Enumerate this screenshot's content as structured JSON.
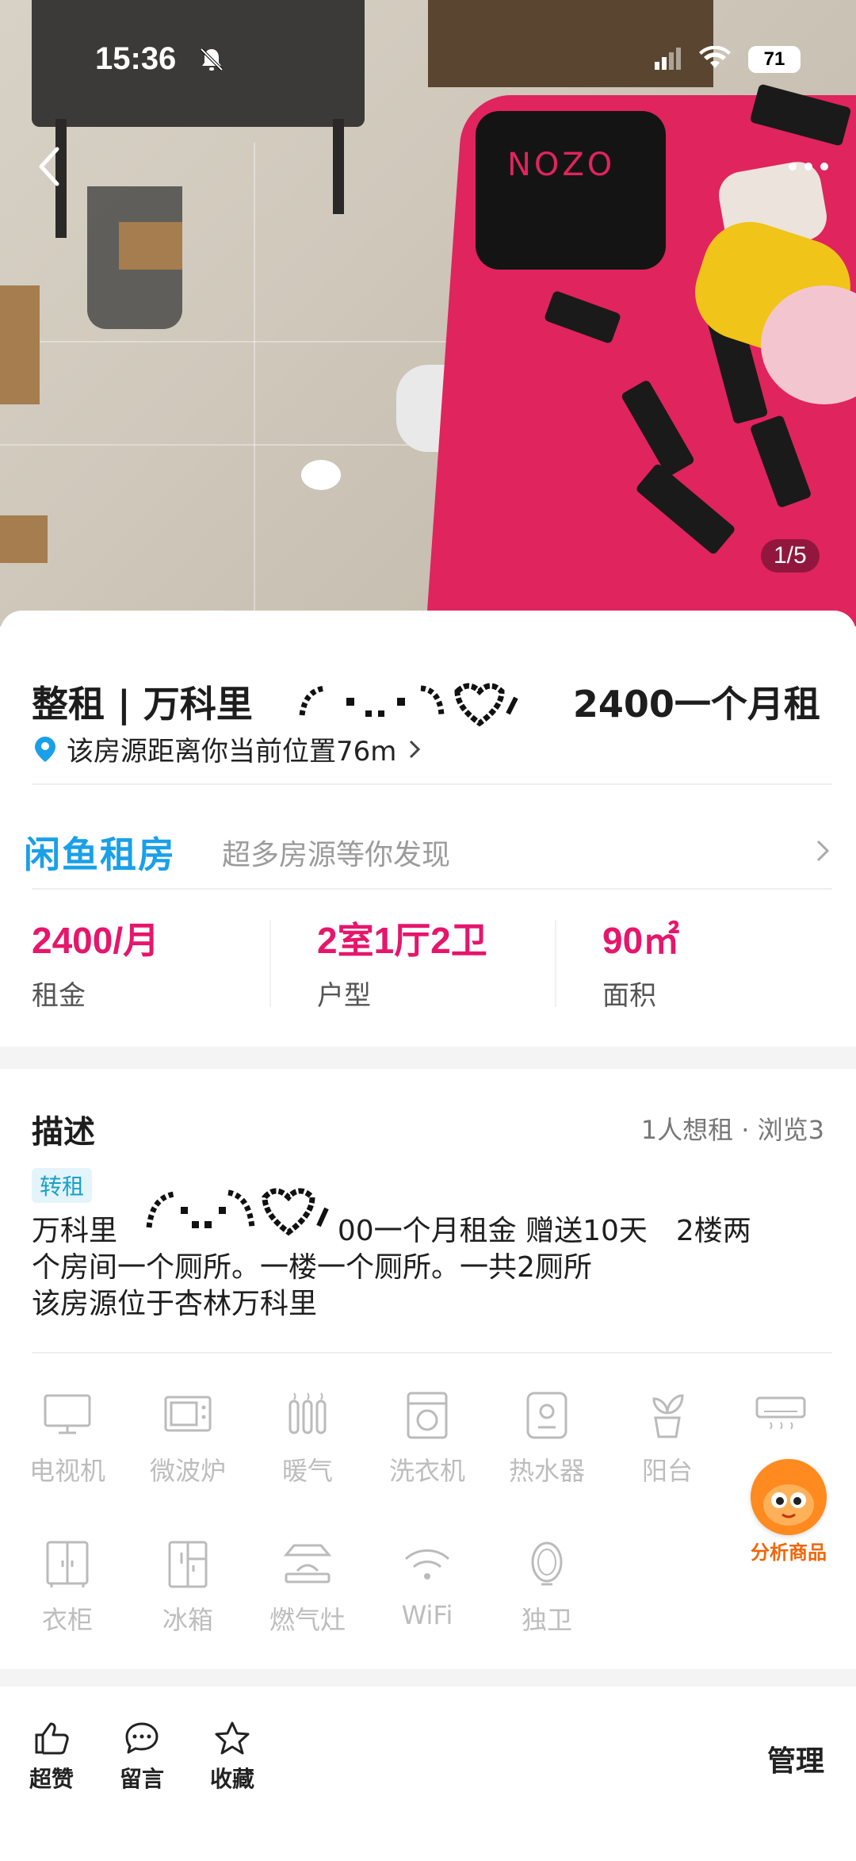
{
  "status_bar": {
    "time": "15:36",
    "battery": "71"
  },
  "gallery": {
    "counter": "1/5",
    "pillow_text": "NOZO"
  },
  "listing": {
    "title_prefix": "整租 | 万科里",
    "title_suffix": "2400一个月租",
    "location_text": "该房源距离你当前位置76m"
  },
  "brand": {
    "logo": "闲鱼租房",
    "subtitle": "超多房源等你发现"
  },
  "stats": [
    {
      "value": "2400/月",
      "label": "租金"
    },
    {
      "value": "2室1厅2卫",
      "label": "户型"
    },
    {
      "value": "90㎡",
      "label": "面积"
    }
  ],
  "description": {
    "heading": "描述",
    "meta": "1人想租 · 浏览3",
    "tag": "转租",
    "line1_prefix": "万科里",
    "line1_suffix": "2400一个月租金 赠送10天　2楼两",
    "line2": "个房间一个厕所。一楼一个厕所。一共2厕所",
    "line3": "该房源位于杏林万科里"
  },
  "amenities": [
    {
      "label": "电视机",
      "icon": "tv-icon"
    },
    {
      "label": "微波炉",
      "icon": "microwave-icon"
    },
    {
      "label": "暖气",
      "icon": "radiator-icon"
    },
    {
      "label": "洗衣机",
      "icon": "washing-machine-icon"
    },
    {
      "label": "热水器",
      "icon": "water-heater-icon"
    },
    {
      "label": "阳台",
      "icon": "balcony-plant-icon"
    },
    {
      "label": "",
      "icon": "air-conditioner-icon"
    },
    {
      "label": "衣柜",
      "icon": "wardrobe-icon"
    },
    {
      "label": "冰箱",
      "icon": "fridge-icon"
    },
    {
      "label": "燃气灶",
      "icon": "gas-stove-icon"
    },
    {
      "label": "WiFi",
      "icon": "wifi-icon"
    },
    {
      "label": "独卫",
      "icon": "mirror-bathroom-icon"
    }
  ],
  "floating": {
    "label": "分析商品"
  },
  "bottom_bar": {
    "like": "超赞",
    "comment": "留言",
    "favorite": "收藏",
    "manage": "管理"
  },
  "colors": {
    "accent": "#e5166b",
    "brand_blue": "#1aa0e8",
    "float_orange": "#ff8a1f"
  }
}
